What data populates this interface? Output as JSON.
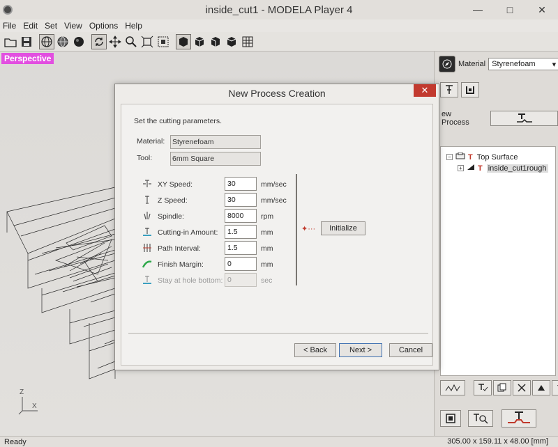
{
  "window": {
    "title": "inside_cut1 - MODELA Player 4",
    "minimize": "—",
    "maximize": "□",
    "close": "✕"
  },
  "menu": [
    "File",
    "Edit",
    "Set",
    "View",
    "Options",
    "Help"
  ],
  "viewport": {
    "label": "Perspective",
    "axis_z": "Z",
    "axis_x": "X"
  },
  "right_panel": {
    "material_label": "Material",
    "material_value": "Styrenefoam",
    "new_process_label": "ew Process",
    "tree": {
      "root": "Top Surface",
      "child": "inside_cut1rough"
    }
  },
  "dialog": {
    "title": "New Process Creation",
    "instruction": "Set the cutting parameters.",
    "material_label": "Material:",
    "material_value": "Styrenefoam",
    "tool_label": "Tool:",
    "tool_value": "6mm Square",
    "params": [
      {
        "label": "XY Speed:",
        "value": "30",
        "unit": "mm/sec",
        "enabled": true
      },
      {
        "label": "Z Speed:",
        "value": "30",
        "unit": "mm/sec",
        "enabled": true
      },
      {
        "label": "Spindle:",
        "value": "8000",
        "unit": "rpm",
        "enabled": true
      },
      {
        "label": "Cutting-in Amount:",
        "value": "1.5",
        "unit": "mm",
        "enabled": true
      },
      {
        "label": "Path Interval:",
        "value": "1.5",
        "unit": "mm",
        "enabled": true
      },
      {
        "label": "Finish Margin:",
        "value": "0",
        "unit": "mm",
        "enabled": true
      },
      {
        "label": "Stay at hole bottom:",
        "value": "0",
        "unit": "sec",
        "enabled": false
      }
    ],
    "initialize_label": "Initialize",
    "back_label": "< Back",
    "next_label": "Next >",
    "cancel_label": "Cancel"
  },
  "status": {
    "text": "Ready",
    "dimensions": "305.00 x 159.11 x 48.00 [mm]"
  },
  "colors": {
    "perspective_label": "#e24fe0",
    "close_button": "#c23a2f",
    "accent_red": "#c0392b"
  }
}
